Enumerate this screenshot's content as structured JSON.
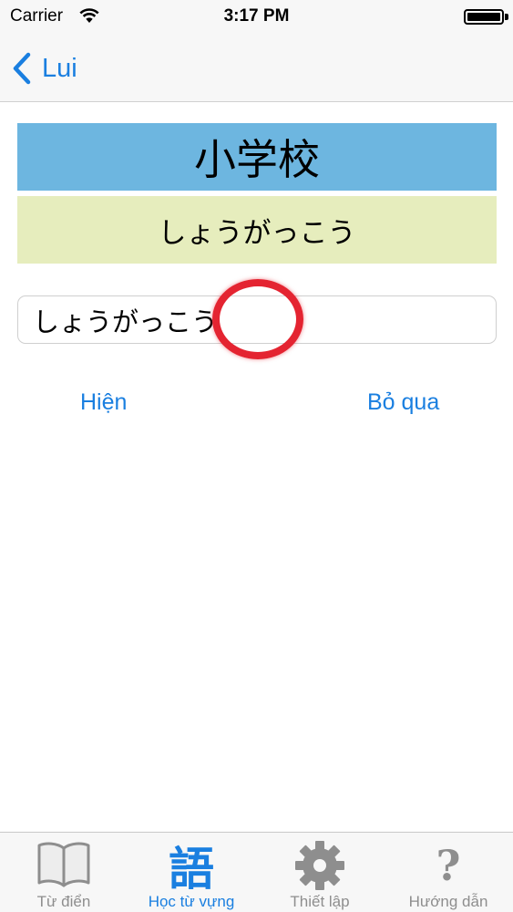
{
  "status_bar": {
    "carrier": "Carrier",
    "time": "3:17 PM"
  },
  "nav": {
    "back_label": "Lui"
  },
  "card": {
    "kanji": "小学校",
    "reading": "しょうがっこう"
  },
  "answer": {
    "value": "しょうがっこう"
  },
  "actions": {
    "show_label": "Hiện",
    "skip_label": "Bỏ qua"
  },
  "tabs": [
    {
      "label": "Từ điển",
      "icon": "book-icon",
      "active": false
    },
    {
      "label": "Học từ vựng",
      "icon": "kanji-go-icon",
      "active": true
    },
    {
      "label": "Thiết lập",
      "icon": "gear-icon",
      "active": false
    },
    {
      "label": "Hướng dẫn",
      "icon": "question-icon",
      "active": false
    }
  ],
  "colors": {
    "accent": "#1a7fe0",
    "kanji_background": "#6db6e0",
    "reading_background": "#e6edbd",
    "touch_indicator": "#e42431",
    "inactive_tab": "#8e8e8e"
  }
}
